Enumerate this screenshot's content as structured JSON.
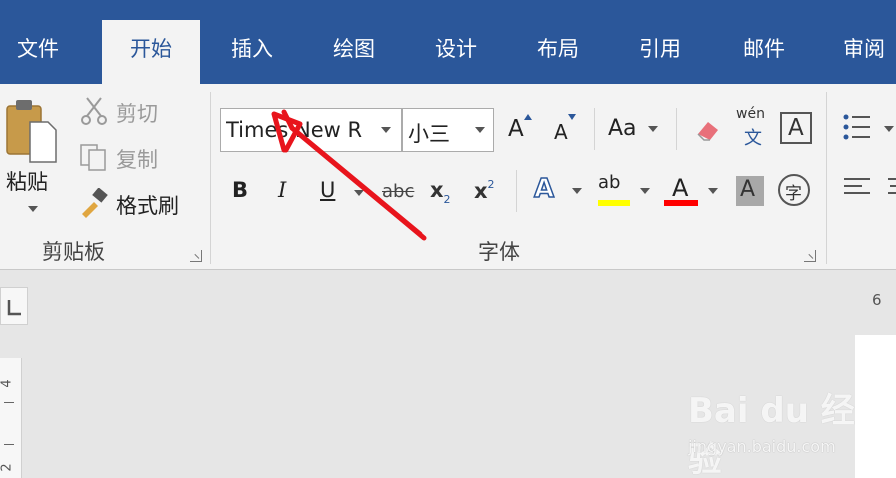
{
  "tabs": [
    {
      "label": "文件",
      "active": false
    },
    {
      "label": "开始",
      "active": true
    },
    {
      "label": "插入",
      "active": false
    },
    {
      "label": "绘图",
      "active": false
    },
    {
      "label": "设计",
      "active": false
    },
    {
      "label": "布局",
      "active": false
    },
    {
      "label": "引用",
      "active": false
    },
    {
      "label": "邮件",
      "active": false
    },
    {
      "label": "审阅",
      "active": false
    }
  ],
  "clipboard": {
    "paste_label": "粘贴",
    "cut_label": "剪切",
    "copy_label": "复制",
    "format_painter_label": "格式刷",
    "group_label": "剪贴板"
  },
  "font": {
    "font_name": "Times New R",
    "font_size": "小三",
    "change_case_label": "Aa",
    "bold": "B",
    "italic": "I",
    "underline": "U",
    "strikethrough": "abc",
    "subscript_base": "x",
    "subscript": "2",
    "superscript_base": "x",
    "superscript": "2",
    "grow_label": "A",
    "shrink_label": "A",
    "text_effects_label": "A",
    "highlight_label": "ab",
    "font_color_label": "A",
    "char_shading_label": "A",
    "enclosed_char_label": "字",
    "phonetic_top": "wén",
    "phonetic_bottom": "文",
    "char_border_label": "A",
    "group_label": "字体"
  },
  "colors": {
    "tabbar": "#2b579a",
    "highlight": "#ffff00",
    "font_color": "#ff0000",
    "annotation_arrow": "#e8141c"
  },
  "document": {
    "vruler_marks": [
      "4",
      "2"
    ],
    "hruler_mark": "6"
  },
  "watermark": {
    "brand": "Bai du 经验",
    "url": "jingyan.baidu.com"
  }
}
